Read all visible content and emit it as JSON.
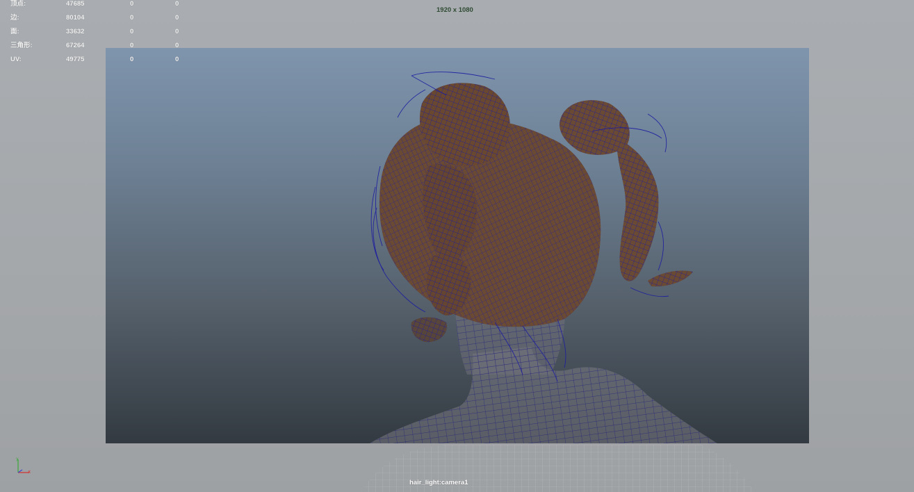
{
  "hud": {
    "rows": [
      {
        "label": "顶点:",
        "v1": "47685",
        "v2": "0",
        "v3": "0"
      },
      {
        "label": "边:",
        "v1": "80104",
        "v2": "0",
        "v3": "0"
      },
      {
        "label": "面:",
        "v1": "33632",
        "v2": "0",
        "v3": "0"
      },
      {
        "label": "三角形:",
        "v1": "67264",
        "v2": "0",
        "v3": "0"
      },
      {
        "label": "UV:",
        "v1": "49775",
        "v2": "0",
        "v3": "0"
      }
    ]
  },
  "resolution_label": "1920 x 1080",
  "camera_name": "hair_light:camera1",
  "colors": {
    "wireframe": "#1a1aa0",
    "hair": "#6b4a34",
    "viewport_bg": "#a6a9ac",
    "gate_top": "#7f95ad",
    "gate_bottom": "#333a41"
  },
  "icons": {
    "axis": "xyz-axis-icon"
  }
}
